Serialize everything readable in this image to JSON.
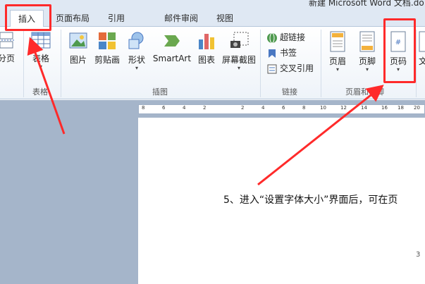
{
  "window": {
    "title": "新建 Microsoft Word 文档.do"
  },
  "tabs": [
    {
      "label": "插入",
      "active": true
    },
    {
      "label": "页面布局"
    },
    {
      "label": "引用"
    },
    {
      "label": "邮件"
    },
    {
      "label": "审阅"
    },
    {
      "label": "视图"
    }
  ],
  "ribbon": {
    "page_break": "分页",
    "table": "表格",
    "picture": "图片",
    "clipart": "剪贴画",
    "shapes": "形状",
    "smartart": "SmartArt",
    "chart": "图表",
    "screenshot": "屏幕截图",
    "hyperlink": "超链接",
    "bookmark": "书签",
    "crossref": "交叉引用",
    "header": "页眉",
    "footer": "页脚",
    "page_number": "页码",
    "text_partial": "文"
  },
  "groups": {
    "tables": "表格",
    "illustrations": "插图",
    "links": "链接",
    "header_footer": "页眉和页脚"
  },
  "ruler": {
    "labels": [
      "8",
      "6",
      "4",
      "2",
      "2",
      "4",
      "6",
      "8",
      "10",
      "12",
      "14",
      "16",
      "18",
      "20"
    ]
  },
  "document": {
    "line": "5、进入“设置字体大小”界面后，可在页",
    "page_number": "3"
  },
  "colors": {
    "accent": "#ff2a2a",
    "ribbon_bg": "#dfe8f3"
  }
}
